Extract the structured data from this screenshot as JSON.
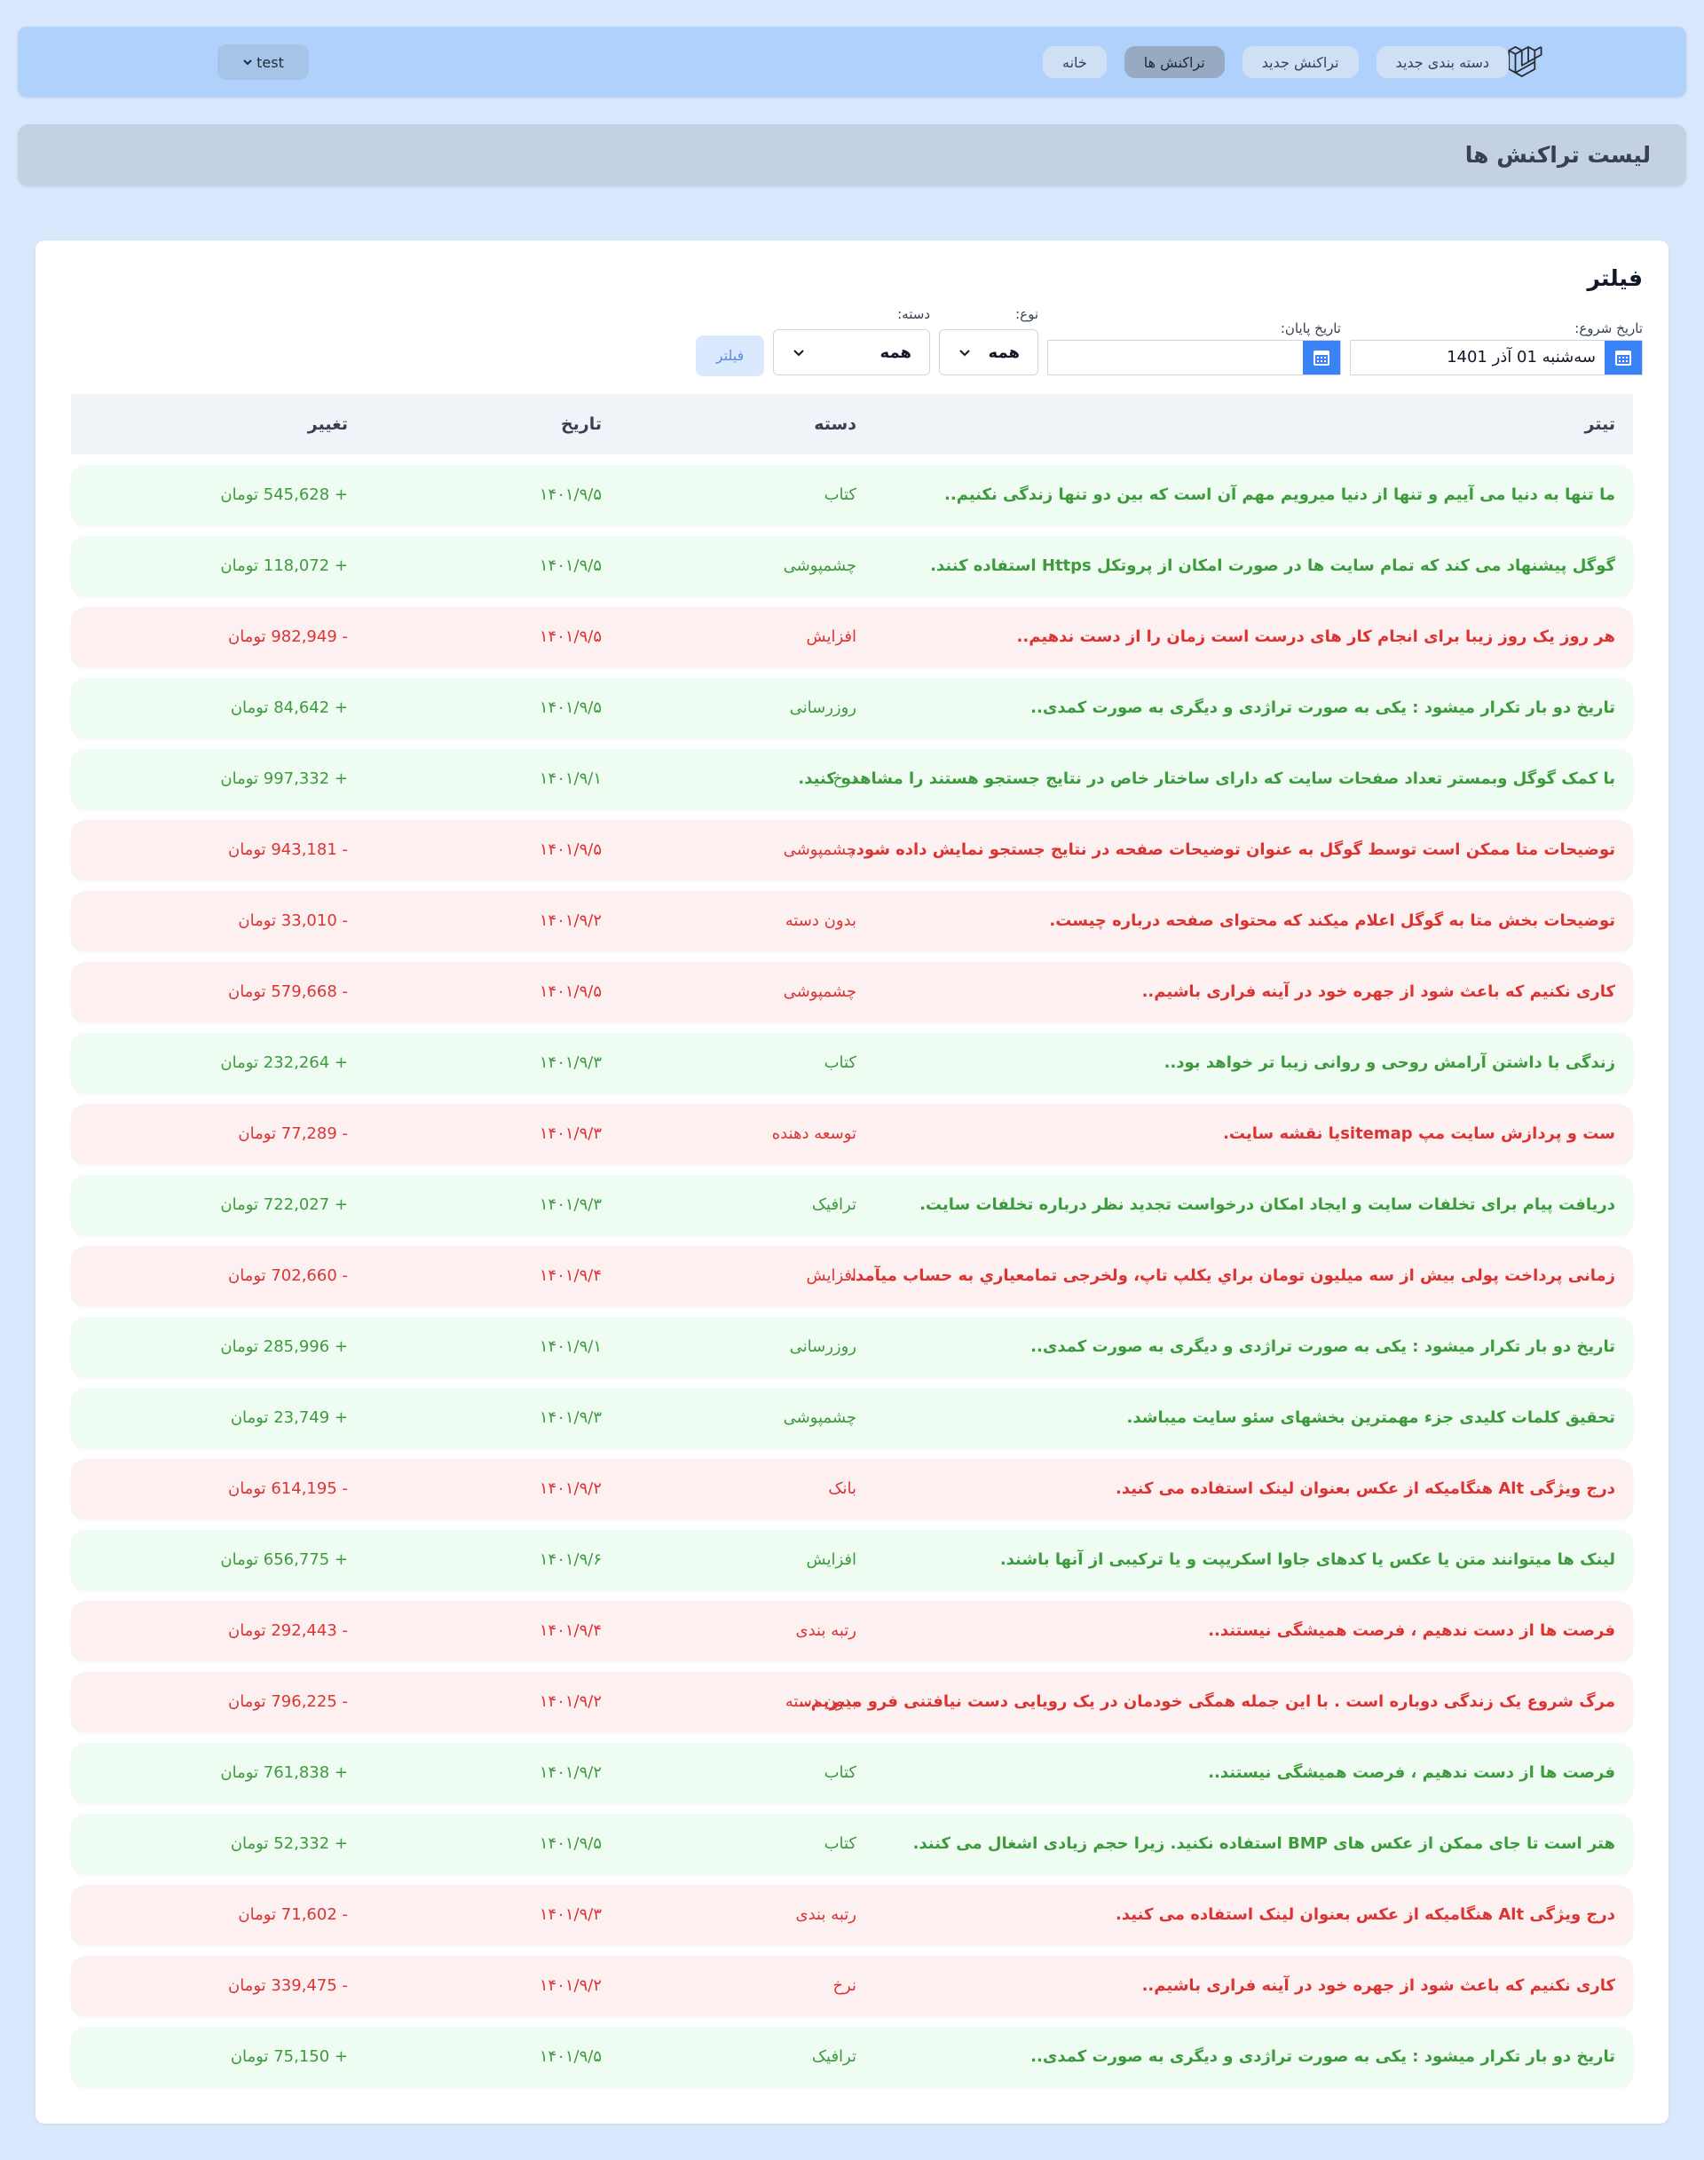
{
  "nav": {
    "links": [
      {
        "label": "خانه",
        "active": false
      },
      {
        "label": "تراکنش ها",
        "active": true
      },
      {
        "label": "تراکنش جدید",
        "active": false
      },
      {
        "label": "دسته بندی جدید",
        "active": false
      }
    ],
    "user": {
      "label": "test",
      "icon": "chevron-down-icon"
    },
    "logo_icon": "laravel-logo-icon"
  },
  "header": {
    "title": "لیست تراکنش ها"
  },
  "filter": {
    "title": "فیلتر",
    "start_date_label": "تاریخ شروع:",
    "start_date_value": "سه‌شنبه 01 آذر 1401",
    "end_date_label": "تاریخ پایان:",
    "end_date_value": "",
    "type_label": "نوع:",
    "type_value": "همه",
    "category_label": "دسته:",
    "category_value": "همه",
    "submit_label": "فیلتر",
    "calendar_icon": "calendar-icon"
  },
  "table": {
    "headers": {
      "title": "تیتر",
      "category": "دسته",
      "date": "تاریخ",
      "change": "تغییر"
    },
    "colors": {
      "income": "#3d9a3d",
      "expense": "#dc3333",
      "income_bg": "#effcf2",
      "expense_bg": "#fdf0f0"
    },
    "rows": [
      {
        "type": "income",
        "title": "ما تنها به دنیا می آییم و تنها از دنیا میرویم مهم آن است که بین دو تنها زندگی نکنیم..",
        "category": "کتاب",
        "date": "۱۴۰۱/۹/۵",
        "amount": "+ 545,628 تومان"
      },
      {
        "type": "income",
        "title": "گوگل پیشنهاد می کند که تمام سایت ها در صورت امکان از پروتکل Https استفاده کنند.",
        "category": "چشمپوشی",
        "date": "۱۴۰۱/۹/۵",
        "amount": "+ 118,072 تومان"
      },
      {
        "type": "expense",
        "title": "هر روز یک روز زیبا برای انجام کار های درست است زمان را از دست ندهیم..",
        "category": "افزایش",
        "date": "۱۴۰۱/۹/۵",
        "amount": "- 982,949 تومان"
      },
      {
        "type": "income",
        "title": "تاریخ دو بار تکرار میشود : یکی به صورت تراژدی و دیگری به صورت کمدی..",
        "category": "روزرسانی",
        "date": "۱۴۰۱/۹/۵",
        "amount": "+ 84,642 تومان"
      },
      {
        "type": "income",
        "title": "با کمک گوگل وبمستر تعداد صفحات سایت که دارای ساختار خاص در نتایج جستجو هستند را مشاهده کنید.",
        "category": "نرخ",
        "date": "۱۴۰۱/۹/۱",
        "amount": "+ 997,332 تومان"
      },
      {
        "type": "expense",
        "title": "توضیحات متا ممکن است توسط گوگل به عنوان توضیحات صفحه در نتایج جستجو نمایش داده شود.",
        "category": "چشمپوشی",
        "date": "۱۴۰۱/۹/۵",
        "amount": "- 943,181 تومان"
      },
      {
        "type": "expense",
        "title": "توضیحات بخش متا به گوگل اعلام میکند که محتوای صفحه درباره چیست.",
        "category": "بدون دسته",
        "date": "۱۴۰۱/۹/۲",
        "amount": "- 33,010 تومان"
      },
      {
        "type": "expense",
        "title": "کاری نکنیم که باعث شود از جهره خود در آینه فراری باشیم..",
        "category": "چشمپوشی",
        "date": "۱۴۰۱/۹/۵",
        "amount": "- 579,668 تومان"
      },
      {
        "type": "income",
        "title": "زندگی با داشتن آرامش روحی و روانی زیبا تر خواهد بود..",
        "category": "کتاب",
        "date": "۱۴۰۱/۹/۳",
        "amount": "+ 232,264 تومان"
      },
      {
        "type": "expense",
        "title": "ست و پردازش سایت مپ sitemapیا نقشه سایت.",
        "category": "توسعه دهنده",
        "date": "۱۴۰۱/۹/۳",
        "amount": "- 77,289 تومان"
      },
      {
        "type": "income",
        "title": "دریافت پیام برای تخلفات سایت و ایجاد امکان درخواست تجدید نظر درباره تخلفات سایت.",
        "category": "ترافیک",
        "date": "۱۴۰۱/۹/۳",
        "amount": "+ 722,027 تومان"
      },
      {
        "type": "expense",
        "title": "زمانی پرداخت پولی بیش از سه میلیون تومان براي يکلپ تاپ، ولخرجی تمامعیاري به حساب میآمد.",
        "category": "افزایش",
        "date": "۱۴۰۱/۹/۴",
        "amount": "- 702,660 تومان"
      },
      {
        "type": "income",
        "title": "تاریخ دو بار تکرار میشود : یکی به صورت تراژدی و دیگری به صورت کمدی..",
        "category": "روزرسانی",
        "date": "۱۴۰۱/۹/۱",
        "amount": "+ 285,996 تومان"
      },
      {
        "type": "income",
        "title": "تحقیق کلمات کلیدی جزء مهمترین بخشهای سئو سایت میباشد.",
        "category": "چشمپوشی",
        "date": "۱۴۰۱/۹/۳",
        "amount": "+ 23,749 تومان"
      },
      {
        "type": "expense",
        "title": "درج ویژگی Alt هنگامیکه از عکس بعنوان لینک استفاده می کنید.",
        "category": "بانک",
        "date": "۱۴۰۱/۹/۲",
        "amount": "- 614,195 تومان"
      },
      {
        "type": "income",
        "title": "لینک ها میتوانند متن یا عکس یا کدهای جاوا اسکریپت و یا ترکیبی از آنها باشند.",
        "category": "افزایش",
        "date": "۱۴۰۱/۹/۶",
        "amount": "+ 656,775 تومان"
      },
      {
        "type": "expense",
        "title": "فرصت ها از دست ندهیم ، فرصت همیشگی نیستند..",
        "category": "رتبه بندی",
        "date": "۱۴۰۱/۹/۴",
        "amount": "- 292,443 تومان"
      },
      {
        "type": "expense",
        "title": "مرگ شروع یک زندگی دوباره است . با این جمله همگی خودمان در یک رویایی دست نیافتنی فرو میبریم..",
        "category": "بدون دسته",
        "date": "۱۴۰۱/۹/۲",
        "amount": "- 796,225 تومان"
      },
      {
        "type": "income",
        "title": "فرصت ها از دست ندهیم ، فرصت همیشگی نیستند..",
        "category": "کتاب",
        "date": "۱۴۰۱/۹/۲",
        "amount": "+ 761,838 تومان"
      },
      {
        "type": "income",
        "title": "هتر است تا جای ممکن از عکس های BMP استفاده نکنید. زیرا حجم زیادی اشغال می کنند.",
        "category": "کتاب",
        "date": "۱۴۰۱/۹/۵",
        "amount": "+ 52,332 تومان"
      },
      {
        "type": "expense",
        "title": "درج ویژگی Alt هنگامیکه از عکس بعنوان لینک استفاده می کنید.",
        "category": "رتبه بندی",
        "date": "۱۴۰۱/۹/۳",
        "amount": "- 71,602 تومان"
      },
      {
        "type": "expense",
        "title": "کاری نکنیم که باعث شود از جهره خود در آینه فراری باشیم..",
        "category": "نرخ",
        "date": "۱۴۰۱/۹/۲",
        "amount": "- 339,475 تومان"
      },
      {
        "type": "income",
        "title": "تاریخ دو بار تکرار میشود : یکی به صورت تراژدی و دیگری به صورت کمدی..",
        "category": "ترافیک",
        "date": "۱۴۰۱/۹/۵",
        "amount": "+ 75,150 تومان"
      }
    ]
  }
}
